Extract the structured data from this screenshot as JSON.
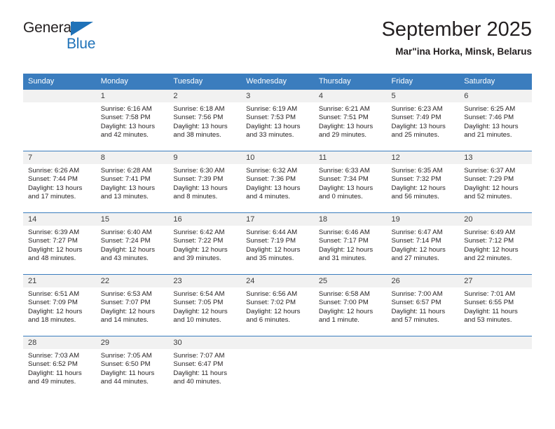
{
  "brand": {
    "name_part1": "General",
    "name_part2": "Blue",
    "flag_icon": "triangle-flag-icon"
  },
  "header": {
    "title": "September 2025",
    "subtitle": "Mar\"ina Horka, Minsk, Belarus"
  },
  "colors": {
    "header_band": "#3b7dbe",
    "daynum_band": "#f1f1f1",
    "brand_blue": "#1f72b8",
    "text": "#231f20"
  },
  "weekdays": [
    "Sunday",
    "Monday",
    "Tuesday",
    "Wednesday",
    "Thursday",
    "Friday",
    "Saturday"
  ],
  "weeks": [
    [
      {
        "day": "",
        "sunrise": "",
        "sunset": "",
        "daylight": "",
        "empty": true
      },
      {
        "day": "1",
        "sunrise": "Sunrise: 6:16 AM",
        "sunset": "Sunset: 7:58 PM",
        "daylight": "Daylight: 13 hours and 42 minutes."
      },
      {
        "day": "2",
        "sunrise": "Sunrise: 6:18 AM",
        "sunset": "Sunset: 7:56 PM",
        "daylight": "Daylight: 13 hours and 38 minutes."
      },
      {
        "day": "3",
        "sunrise": "Sunrise: 6:19 AM",
        "sunset": "Sunset: 7:53 PM",
        "daylight": "Daylight: 13 hours and 33 minutes."
      },
      {
        "day": "4",
        "sunrise": "Sunrise: 6:21 AM",
        "sunset": "Sunset: 7:51 PM",
        "daylight": "Daylight: 13 hours and 29 minutes."
      },
      {
        "day": "5",
        "sunrise": "Sunrise: 6:23 AM",
        "sunset": "Sunset: 7:49 PM",
        "daylight": "Daylight: 13 hours and 25 minutes."
      },
      {
        "day": "6",
        "sunrise": "Sunrise: 6:25 AM",
        "sunset": "Sunset: 7:46 PM",
        "daylight": "Daylight: 13 hours and 21 minutes."
      }
    ],
    [
      {
        "day": "7",
        "sunrise": "Sunrise: 6:26 AM",
        "sunset": "Sunset: 7:44 PM",
        "daylight": "Daylight: 13 hours and 17 minutes."
      },
      {
        "day": "8",
        "sunrise": "Sunrise: 6:28 AM",
        "sunset": "Sunset: 7:41 PM",
        "daylight": "Daylight: 13 hours and 13 minutes."
      },
      {
        "day": "9",
        "sunrise": "Sunrise: 6:30 AM",
        "sunset": "Sunset: 7:39 PM",
        "daylight": "Daylight: 13 hours and 8 minutes."
      },
      {
        "day": "10",
        "sunrise": "Sunrise: 6:32 AM",
        "sunset": "Sunset: 7:36 PM",
        "daylight": "Daylight: 13 hours and 4 minutes."
      },
      {
        "day": "11",
        "sunrise": "Sunrise: 6:33 AM",
        "sunset": "Sunset: 7:34 PM",
        "daylight": "Daylight: 13 hours and 0 minutes."
      },
      {
        "day": "12",
        "sunrise": "Sunrise: 6:35 AM",
        "sunset": "Sunset: 7:32 PM",
        "daylight": "Daylight: 12 hours and 56 minutes."
      },
      {
        "day": "13",
        "sunrise": "Sunrise: 6:37 AM",
        "sunset": "Sunset: 7:29 PM",
        "daylight": "Daylight: 12 hours and 52 minutes."
      }
    ],
    [
      {
        "day": "14",
        "sunrise": "Sunrise: 6:39 AM",
        "sunset": "Sunset: 7:27 PM",
        "daylight": "Daylight: 12 hours and 48 minutes."
      },
      {
        "day": "15",
        "sunrise": "Sunrise: 6:40 AM",
        "sunset": "Sunset: 7:24 PM",
        "daylight": "Daylight: 12 hours and 43 minutes."
      },
      {
        "day": "16",
        "sunrise": "Sunrise: 6:42 AM",
        "sunset": "Sunset: 7:22 PM",
        "daylight": "Daylight: 12 hours and 39 minutes."
      },
      {
        "day": "17",
        "sunrise": "Sunrise: 6:44 AM",
        "sunset": "Sunset: 7:19 PM",
        "daylight": "Daylight: 12 hours and 35 minutes."
      },
      {
        "day": "18",
        "sunrise": "Sunrise: 6:46 AM",
        "sunset": "Sunset: 7:17 PM",
        "daylight": "Daylight: 12 hours and 31 minutes."
      },
      {
        "day": "19",
        "sunrise": "Sunrise: 6:47 AM",
        "sunset": "Sunset: 7:14 PM",
        "daylight": "Daylight: 12 hours and 27 minutes."
      },
      {
        "day": "20",
        "sunrise": "Sunrise: 6:49 AM",
        "sunset": "Sunset: 7:12 PM",
        "daylight": "Daylight: 12 hours and 22 minutes."
      }
    ],
    [
      {
        "day": "21",
        "sunrise": "Sunrise: 6:51 AM",
        "sunset": "Sunset: 7:09 PM",
        "daylight": "Daylight: 12 hours and 18 minutes."
      },
      {
        "day": "22",
        "sunrise": "Sunrise: 6:53 AM",
        "sunset": "Sunset: 7:07 PM",
        "daylight": "Daylight: 12 hours and 14 minutes."
      },
      {
        "day": "23",
        "sunrise": "Sunrise: 6:54 AM",
        "sunset": "Sunset: 7:05 PM",
        "daylight": "Daylight: 12 hours and 10 minutes."
      },
      {
        "day": "24",
        "sunrise": "Sunrise: 6:56 AM",
        "sunset": "Sunset: 7:02 PM",
        "daylight": "Daylight: 12 hours and 6 minutes."
      },
      {
        "day": "25",
        "sunrise": "Sunrise: 6:58 AM",
        "sunset": "Sunset: 7:00 PM",
        "daylight": "Daylight: 12 hours and 1 minute."
      },
      {
        "day": "26",
        "sunrise": "Sunrise: 7:00 AM",
        "sunset": "Sunset: 6:57 PM",
        "daylight": "Daylight: 11 hours and 57 minutes."
      },
      {
        "day": "27",
        "sunrise": "Sunrise: 7:01 AM",
        "sunset": "Sunset: 6:55 PM",
        "daylight": "Daylight: 11 hours and 53 minutes."
      }
    ],
    [
      {
        "day": "28",
        "sunrise": "Sunrise: 7:03 AM",
        "sunset": "Sunset: 6:52 PM",
        "daylight": "Daylight: 11 hours and 49 minutes."
      },
      {
        "day": "29",
        "sunrise": "Sunrise: 7:05 AM",
        "sunset": "Sunset: 6:50 PM",
        "daylight": "Daylight: 11 hours and 44 minutes."
      },
      {
        "day": "30",
        "sunrise": "Sunrise: 7:07 AM",
        "sunset": "Sunset: 6:47 PM",
        "daylight": "Daylight: 11 hours and 40 minutes."
      },
      {
        "day": "",
        "sunrise": "",
        "sunset": "",
        "daylight": "",
        "empty": true
      },
      {
        "day": "",
        "sunrise": "",
        "sunset": "",
        "daylight": "",
        "empty": true
      },
      {
        "day": "",
        "sunrise": "",
        "sunset": "",
        "daylight": "",
        "empty": true
      },
      {
        "day": "",
        "sunrise": "",
        "sunset": "",
        "daylight": "",
        "empty": true
      }
    ]
  ]
}
